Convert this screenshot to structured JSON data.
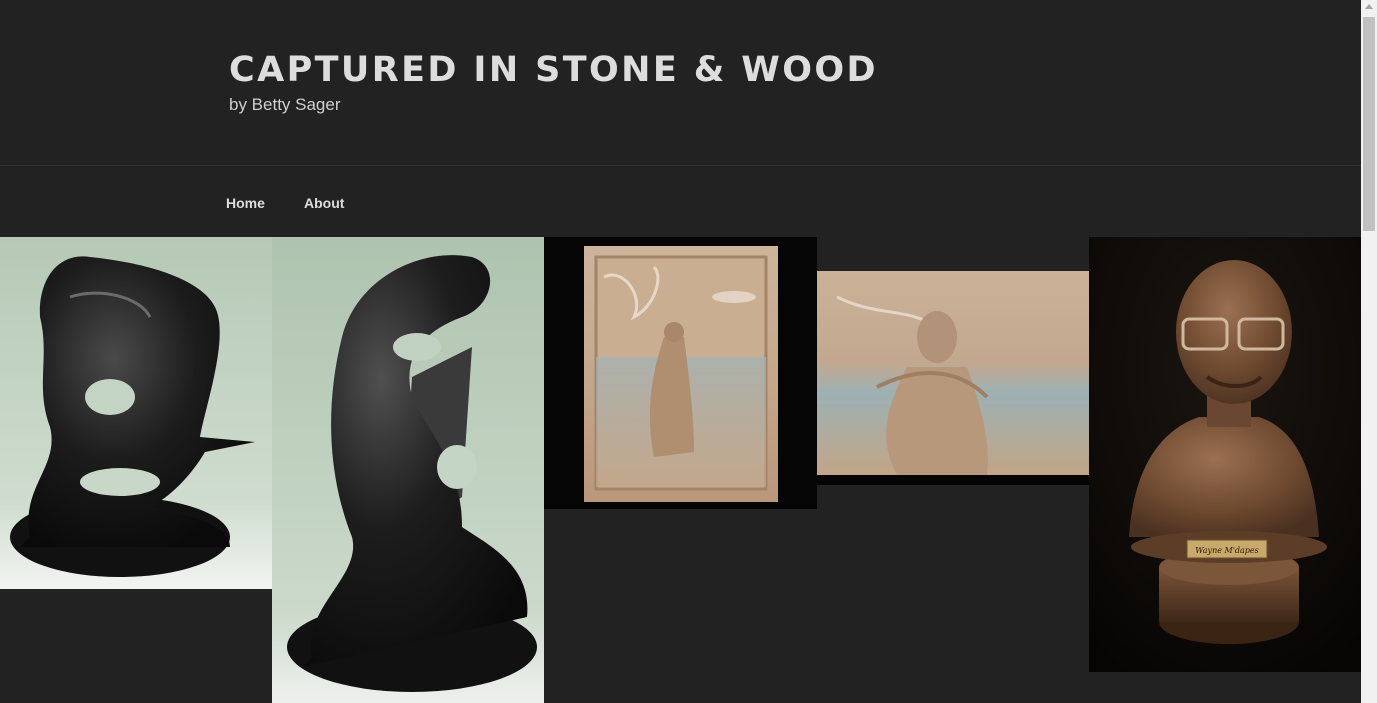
{
  "site": {
    "title": "CAPTURED IN STONE & WOOD",
    "description": "by Betty Sager"
  },
  "nav": {
    "items": [
      {
        "label": "Home"
      },
      {
        "label": "About"
      }
    ]
  },
  "gallery": {
    "items": [
      {
        "subject": "black stone abstract sculpture with bird"
      },
      {
        "subject": "black stone abstract sculpture, side view"
      },
      {
        "subject": "wood relief panel of figure walking on water"
      },
      {
        "subject": "wood relief panel detail of figure"
      },
      {
        "subject": "wood bust of man with glasses on pedestal",
        "plaque": "Wayne M'dapes"
      }
    ]
  },
  "colors": {
    "background": "#222222",
    "title": "#dddddd",
    "subtitle": "#cfcfcf"
  }
}
